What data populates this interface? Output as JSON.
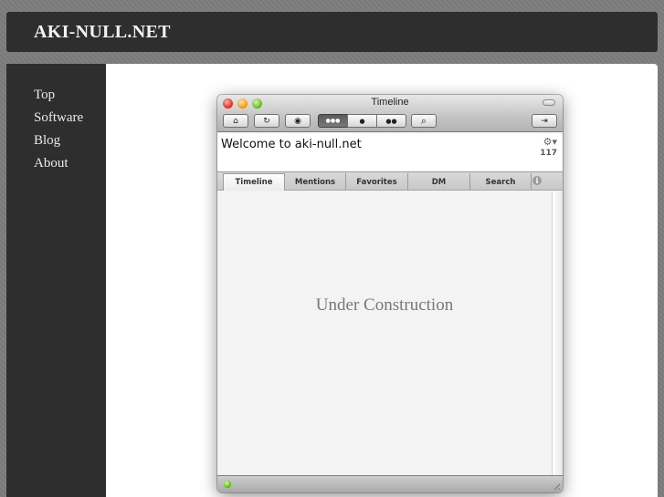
{
  "site": {
    "title": "AKI-NULL.NET",
    "nav": [
      {
        "label": "Top"
      },
      {
        "label": "Software"
      },
      {
        "label": "Blog"
      },
      {
        "label": "About"
      }
    ]
  },
  "window": {
    "title": "Timeline",
    "toolbar": {
      "home_icon": "home-icon",
      "refresh_icon": "refresh-icon",
      "record_icon": "record-icon",
      "timeline_icon": "speech-bubbles-icon",
      "mention_icon": "speech-bubble-icon",
      "dm_icon": "double-bubble-icon",
      "search_icon": "search-icon",
      "post_icon": "post-icon",
      "glyphs": {
        "home": "⌂",
        "refresh": "↻",
        "record": "◉",
        "timeline": "●●●",
        "mention": "●",
        "dm": "●●",
        "search": "⌕",
        "post": "⇥"
      }
    },
    "header": {
      "welcome": "Welcome to aki-null.net",
      "gear_glyph": "⚙▾",
      "count": "117"
    },
    "tabs": [
      {
        "label": "Timeline",
        "active": true
      },
      {
        "label": "Mentions"
      },
      {
        "label": "Favorites"
      },
      {
        "label": "DM"
      },
      {
        "label": "Search"
      }
    ],
    "info_glyph": "i",
    "body_text": "Under Construction",
    "status": {
      "indicator": "online",
      "color": "#5fc21e"
    }
  }
}
